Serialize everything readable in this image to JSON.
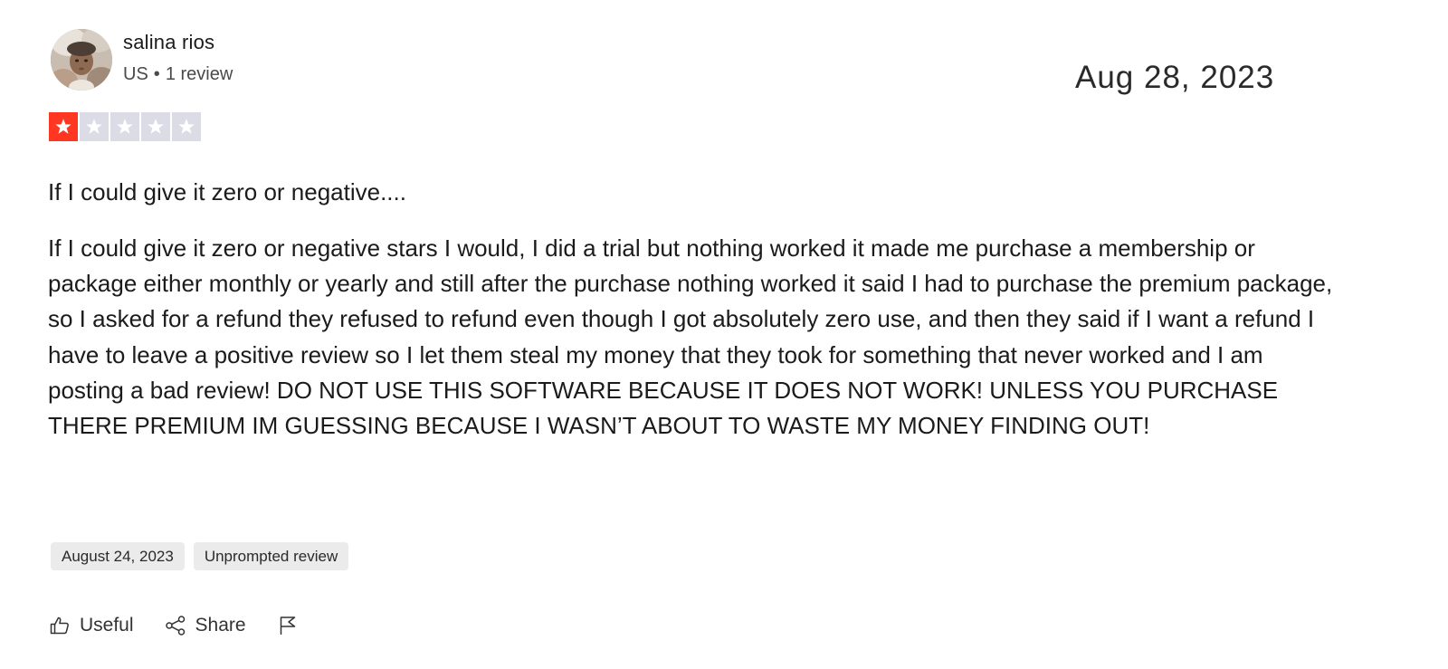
{
  "reviewer": {
    "name": "salina rios",
    "country": "US",
    "separator": "•",
    "review_count": "1 review"
  },
  "review": {
    "date_top": "Aug 28, 2023",
    "rating": 1,
    "max_rating": 5,
    "star_color_on": "#ff3722",
    "star_color_off": "#dcdce6",
    "title": "If I could give it zero or negative....",
    "body": "If I could give it zero or negative stars I would, I did a trial but nothing worked it made me purchase a membership or package either monthly or yearly and still after the purchase nothing worked it said I had to purchase the premium package, so I asked for a refund they refused to refund even though I got absolutely zero use, and then they said if I want a refund I have to leave a positive review so I let them steal my money that they took for something that never worked and I am posting a bad review! DO NOT USE THIS SOFTWARE BECAUSE IT DOES NOT WORK! UNLESS YOU PURCHASE THERE PREMIUM IM GUESSING BECAUSE I WASN’T ABOUT TO WASTE MY MONEY FINDING OUT!"
  },
  "tags": {
    "date_of_experience": "August 24, 2023",
    "review_type": "Unprompted review"
  },
  "actions": {
    "useful_label": "Useful",
    "useful_icon": "thumbs-up-icon",
    "share_label": "Share",
    "share_icon": "share-icon",
    "flag_icon": "flag-icon"
  }
}
